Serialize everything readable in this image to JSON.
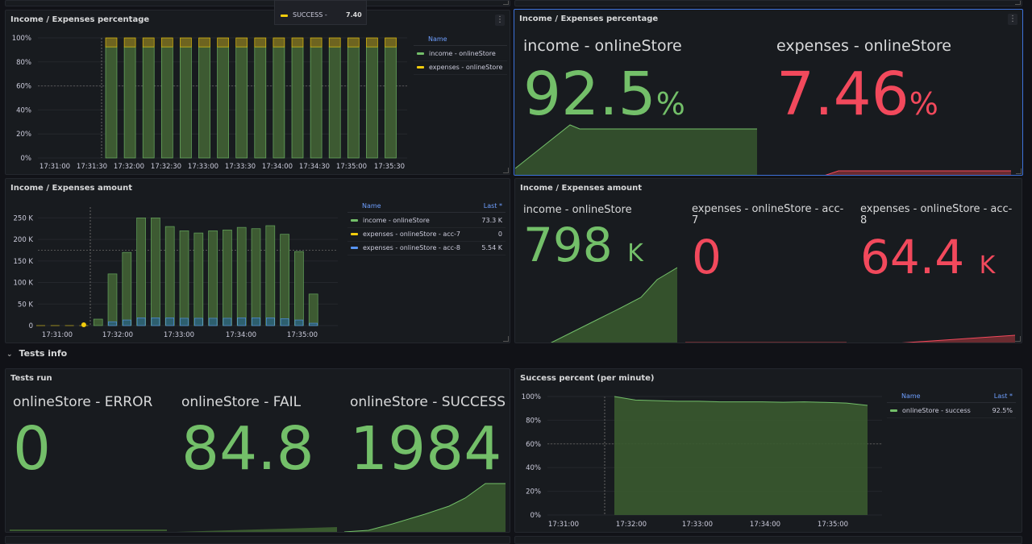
{
  "tooltip": {
    "label": "SUCCESS -",
    "value": "7.40",
    "color": "#f2cc0c"
  },
  "colors": {
    "income": "#73bf69",
    "expenses": "#f2cc0c",
    "acc8": "#5794f2",
    "stat_green": "#73bf69",
    "stat_red": "#f2495c"
  },
  "panel_pct_chart": {
    "title": "Income / Expenses percentage",
    "legend": {
      "header": "Name",
      "items": [
        {
          "name": "income - onlineStore",
          "color": "#73bf69"
        },
        {
          "name": "expenses - onlineStore",
          "color": "#f2cc0c"
        }
      ]
    },
    "chart_data": {
      "type": "bar",
      "title": "Income / Expenses percentage",
      "x_ticks": [
        "17:31:00",
        "17:31:30",
        "17:32:00",
        "17:32:30",
        "17:33:00",
        "17:33:30",
        "17:34:00",
        "17:34:30",
        "17:35:00",
        "17:35:30"
      ],
      "y_ticks": [
        "0%",
        "20%",
        "40%",
        "60%",
        "80%",
        "100%"
      ],
      "ylim": [
        0,
        100
      ],
      "stacked": true,
      "series": [
        {
          "name": "income - onlineStore",
          "color": "#73bf69",
          "values": [
            92.5,
            92.5,
            92.5,
            92.5,
            92.5,
            92.5,
            92.5,
            92.5,
            92.5,
            92.5,
            92.5,
            92.5,
            92.5,
            92.5,
            92.5,
            92.5
          ]
        },
        {
          "name": "expenses - onlineStore",
          "color": "#f2cc0c",
          "values": [
            7.5,
            7.5,
            7.5,
            7.5,
            7.5,
            7.5,
            7.5,
            7.5,
            7.5,
            7.5,
            7.5,
            7.5,
            7.5,
            7.5,
            7.5,
            7.5
          ]
        }
      ]
    }
  },
  "panel_pct_stat": {
    "title": "Income / Expenses percentage",
    "stats": [
      {
        "label": "income - onlineStore",
        "value": "92.5",
        "unit": "%",
        "color": "#73bf69"
      },
      {
        "label": "expenses - onlineStore",
        "value": "7.46",
        "unit": "%",
        "color": "#f2495c"
      }
    ]
  },
  "panel_amount_chart": {
    "title": "Income / Expenses amount",
    "legend": {
      "header": "Name",
      "header_value": "Last *",
      "items": [
        {
          "name": "income - onlineStore",
          "value": "73.3 K",
          "color": "#73bf69"
        },
        {
          "name": "expenses - onlineStore - acc-7",
          "value": "0",
          "color": "#f2cc0c"
        },
        {
          "name": "expenses - onlineStore - acc-8",
          "value": "5.54 K",
          "color": "#5794f2"
        }
      ]
    },
    "chart_data": {
      "type": "bar",
      "title": "Income / Expenses amount",
      "x_ticks": [
        "17:31:00",
        "17:32:00",
        "17:33:00",
        "17:34:00",
        "17:35:00"
      ],
      "y_ticks": [
        "0",
        "50 K",
        "100 K",
        "150 K",
        "200 K",
        "250 K"
      ],
      "ylim": [
        0,
        275000
      ],
      "series": [
        {
          "name": "income - onlineStore",
          "color": "#73bf69",
          "values": [
            0,
            0,
            0,
            0,
            15000,
            120000,
            170000,
            250000,
            250000,
            230000,
            220000,
            215000,
            220000,
            222000,
            228000,
            225000,
            232000,
            212000,
            172000,
            73300
          ]
        },
        {
          "name": "expenses - onlineStore - acc-7",
          "color": "#f2cc0c",
          "values": [
            0,
            0,
            0,
            3000,
            0,
            0,
            0,
            0,
            0,
            0,
            0,
            0,
            0,
            0,
            0,
            0,
            0,
            0,
            0,
            0
          ]
        },
        {
          "name": "expenses - onlineStore - acc-8",
          "color": "#5794f2",
          "values": [
            0,
            0,
            0,
            0,
            0,
            9000,
            13000,
            18000,
            18000,
            18000,
            17000,
            17000,
            17000,
            17000,
            18000,
            18000,
            18000,
            16000,
            13000,
            5540
          ]
        }
      ]
    }
  },
  "panel_amount_stat": {
    "title": "Income / Expenses amount",
    "stats": [
      {
        "label": "income - onlineStore",
        "value": "798",
        "unit": "K",
        "color": "#73bf69"
      },
      {
        "label": "expenses - onlineStore - acc-7",
        "value": "0",
        "unit": "",
        "color": "#f2495c"
      },
      {
        "label": "expenses - onlineStore - acc-8",
        "value": "64.4",
        "unit": "K",
        "color": "#f2495c"
      }
    ]
  },
  "row": {
    "title": "Tests info"
  },
  "panel_tests": {
    "title": "Tests run",
    "stats": [
      {
        "label": "onlineStore - ERROR",
        "value": "0",
        "color": "#73bf69"
      },
      {
        "label": "onlineStore - FAIL",
        "value": "84.8",
        "color": "#73bf69"
      },
      {
        "label": "onlineStore - SUCCESS",
        "value": "1984",
        "color": "#73bf69"
      }
    ]
  },
  "panel_success": {
    "title": "Success percent (per minute)",
    "legend": {
      "header": "Name",
      "header_value": "Last *",
      "items": [
        {
          "name": "onlineStore - success",
          "value": "92.5%",
          "color": "#73bf69"
        }
      ]
    },
    "chart_data": {
      "type": "area",
      "title": "Success percent (per minute)",
      "x_ticks": [
        "17:31:00",
        "17:32:00",
        "17:33:00",
        "17:34:00",
        "17:35:00"
      ],
      "y_ticks": [
        "0%",
        "20%",
        "40%",
        "60%",
        "80%",
        "100%"
      ],
      "ylim": [
        0,
        100
      ],
      "series": [
        {
          "name": "onlineStore - success",
          "color": "#73bf69",
          "values": [
            100,
            97,
            96.5,
            96,
            96,
            95.5,
            95.5,
            95.5,
            95.2,
            95.5,
            95,
            94.5,
            92.5
          ]
        }
      ]
    }
  }
}
